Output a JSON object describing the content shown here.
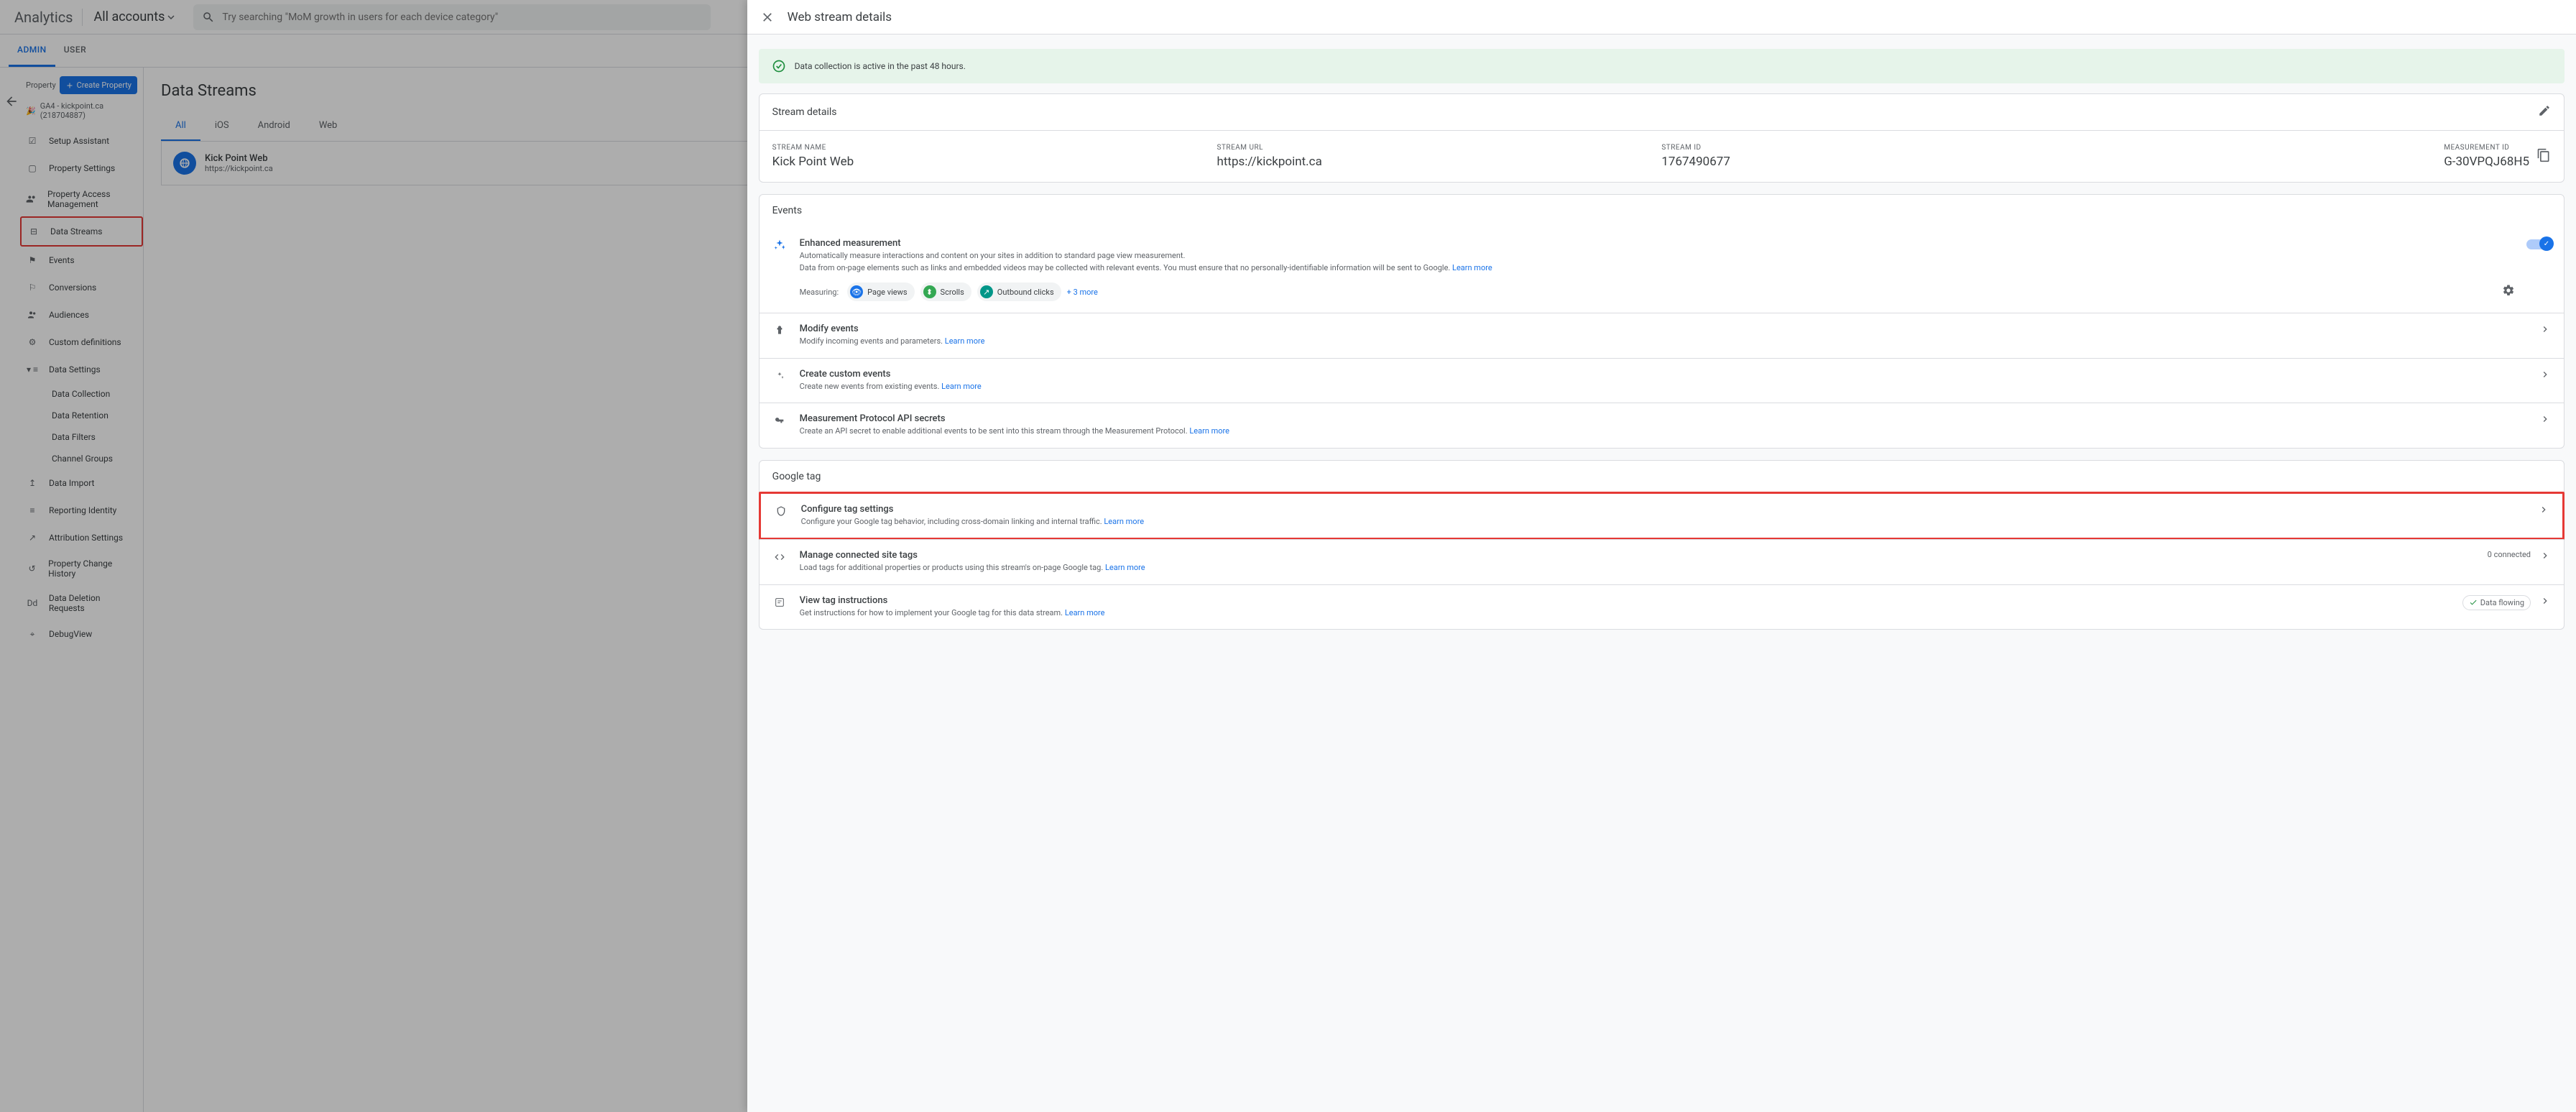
{
  "header": {
    "logo": "Analytics",
    "account": "All accounts",
    "search_placeholder": "Try searching \"MoM growth in users for each device category\""
  },
  "tabs": {
    "admin": "ADMIN",
    "user": "USER"
  },
  "sidebar": {
    "property_label": "Property",
    "create_btn": "Create Property",
    "property_name": "GA4 - kickpoint.ca (218704887)",
    "items": {
      "setup": "Setup Assistant",
      "property_settings": "Property Settings",
      "property_access": "Property Access Management",
      "data_streams": "Data Streams",
      "events": "Events",
      "conversions": "Conversions",
      "audiences": "Audiences",
      "custom_definitions": "Custom definitions",
      "data_settings": "Data Settings",
      "data_collection": "Data Collection",
      "data_retention": "Data Retention",
      "data_filters": "Data Filters",
      "channel_groups": "Channel Groups",
      "data_import": "Data Import",
      "reporting_identity": "Reporting Identity",
      "attribution": "Attribution Settings",
      "change_history": "Property Change History",
      "deletion": "Data Deletion Requests",
      "debugview": "DebugView"
    }
  },
  "content": {
    "title": "Data Streams",
    "filters": {
      "all": "All",
      "ios": "iOS",
      "android": "Android",
      "web": "Web"
    },
    "stream": {
      "name": "Kick Point Web",
      "url": "https://kickpoint.ca"
    }
  },
  "panel": {
    "title": "Web stream details",
    "banner": "Data collection is active in the past 48 hours.",
    "stream_details": {
      "head": "Stream details",
      "name_label": "STREAM NAME",
      "name": "Kick Point Web",
      "url_label": "STREAM URL",
      "url": "https://kickpoint.ca",
      "id_label": "STREAM ID",
      "id": "1767490677",
      "measurement_label": "MEASUREMENT ID",
      "measurement": "G-30VPQJ68H5"
    },
    "events": {
      "head": "Events",
      "enhanced": {
        "title": "Enhanced measurement",
        "desc1": "Automatically measure interactions and content on your sites in addition to standard page view measurement.",
        "desc2": "Data from on-page elements such as links and embedded videos may be collected with relevant events. You must ensure that no personally-identifiable information will be sent to Google. ",
        "learn_more": "Learn more",
        "measuring": "Measuring:",
        "chip_pageviews": "Page views",
        "chip_scrolls": "Scrolls",
        "chip_outbound": "Outbound clicks",
        "more": "+ 3 more"
      },
      "modify": {
        "title": "Modify events",
        "desc": "Modify incoming events and parameters. ",
        "learn": "Learn more"
      },
      "custom": {
        "title": "Create custom events",
        "desc": "Create new events from existing events. ",
        "learn": "Learn more"
      },
      "protocol": {
        "title": "Measurement Protocol API secrets",
        "desc": "Create an API secret to enable additional events to be sent into this stream through the Measurement Protocol. ",
        "learn": "Learn more"
      }
    },
    "gtag": {
      "head": "Google tag",
      "configure": {
        "title": "Configure tag settings",
        "desc": "Configure your Google tag behavior, including cross-domain linking and internal traffic. ",
        "learn": "Learn more"
      },
      "connected": {
        "title": "Manage connected site tags",
        "desc": "Load tags for additional properties or products using this stream's on-page Google tag. ",
        "learn": "Learn more",
        "count": "0 connected"
      },
      "instructions": {
        "title": "View tag instructions",
        "desc": "Get instructions for how to implement your Google tag for this data stream. ",
        "learn": "Learn more",
        "status": "Data flowing"
      }
    }
  }
}
